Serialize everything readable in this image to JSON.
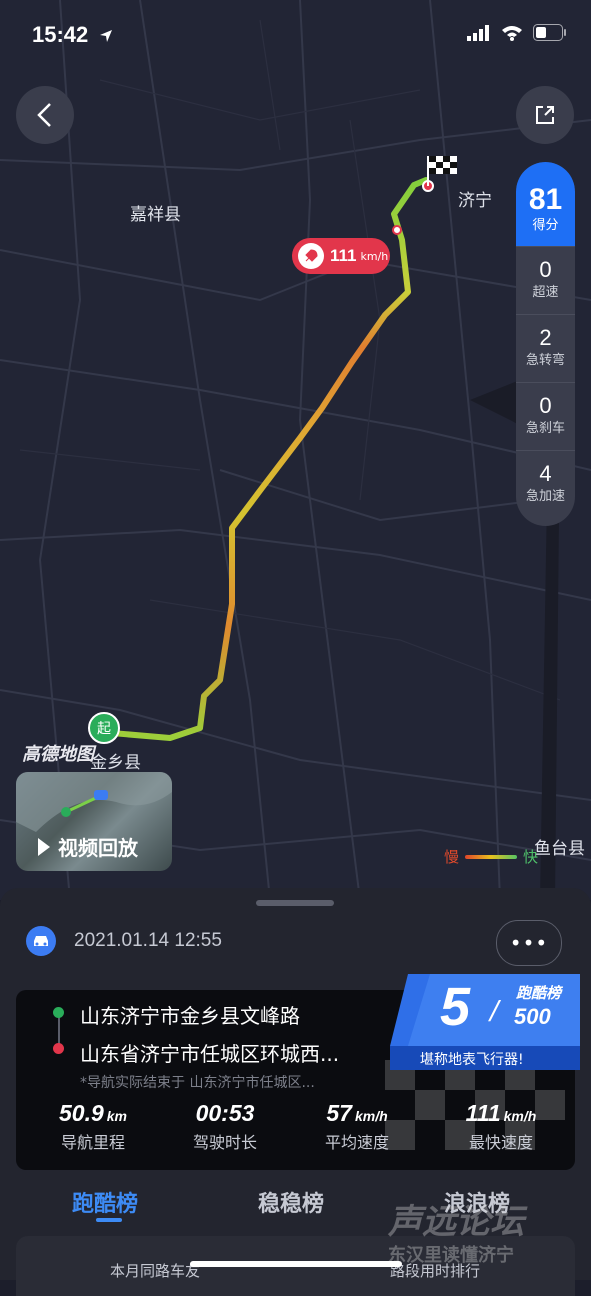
{
  "status_bar": {
    "time": "15:42"
  },
  "map": {
    "places": {
      "jiaxiang": "嘉祥县",
      "jining": "济宁",
      "jinxiang": "金乡县",
      "yutai": "鱼台县"
    },
    "amap_logo": "高德地图",
    "speed_badge": {
      "value": "111",
      "unit": "km/h"
    },
    "start_label": "起",
    "video_button": "视频回放",
    "legend": {
      "slow": "慢",
      "fast": "快"
    }
  },
  "scores": {
    "total": {
      "value": "81",
      "label": "得分"
    },
    "items": [
      {
        "value": "0",
        "label": "超速"
      },
      {
        "value": "2",
        "label": "急转弯"
      },
      {
        "value": "0",
        "label": "急刹车"
      },
      {
        "value": "4",
        "label": "急加速"
      }
    ]
  },
  "trip": {
    "datetime": "2021.01.14 12:55",
    "more": "•••",
    "start_address": "山东济宁市金乡县文峰路",
    "end_address": "山东省济宁市任城区环城西...",
    "note": "*导航实际结束于 山东济宁市任城区...",
    "rank": {
      "title": "跑酷榜",
      "position": "5",
      "separator": "/",
      "total": "500",
      "slogan": "堪称地表飞行器!"
    },
    "stats": [
      {
        "value": "50.9",
        "unit": "km",
        "label": "导航里程"
      },
      {
        "value": "00:53",
        "unit": "",
        "label": "驾驶时长"
      },
      {
        "value": "57",
        "unit": "km/h",
        "label": "平均速度"
      },
      {
        "value": "111",
        "unit": "km/h",
        "label": "最快速度"
      }
    ]
  },
  "tabs": [
    {
      "label": "跑酷榜",
      "active": true,
      "color": "#3d8bf5"
    },
    {
      "label": "稳稳榜",
      "active": false
    },
    {
      "label": "浪浪榜",
      "active": false
    }
  ],
  "sub_panel": {
    "left": "本月同路车友",
    "right": "路段用时排行"
  },
  "watermark": {
    "line1": "声远论坛",
    "line2": "东汉里读懂济宁"
  }
}
